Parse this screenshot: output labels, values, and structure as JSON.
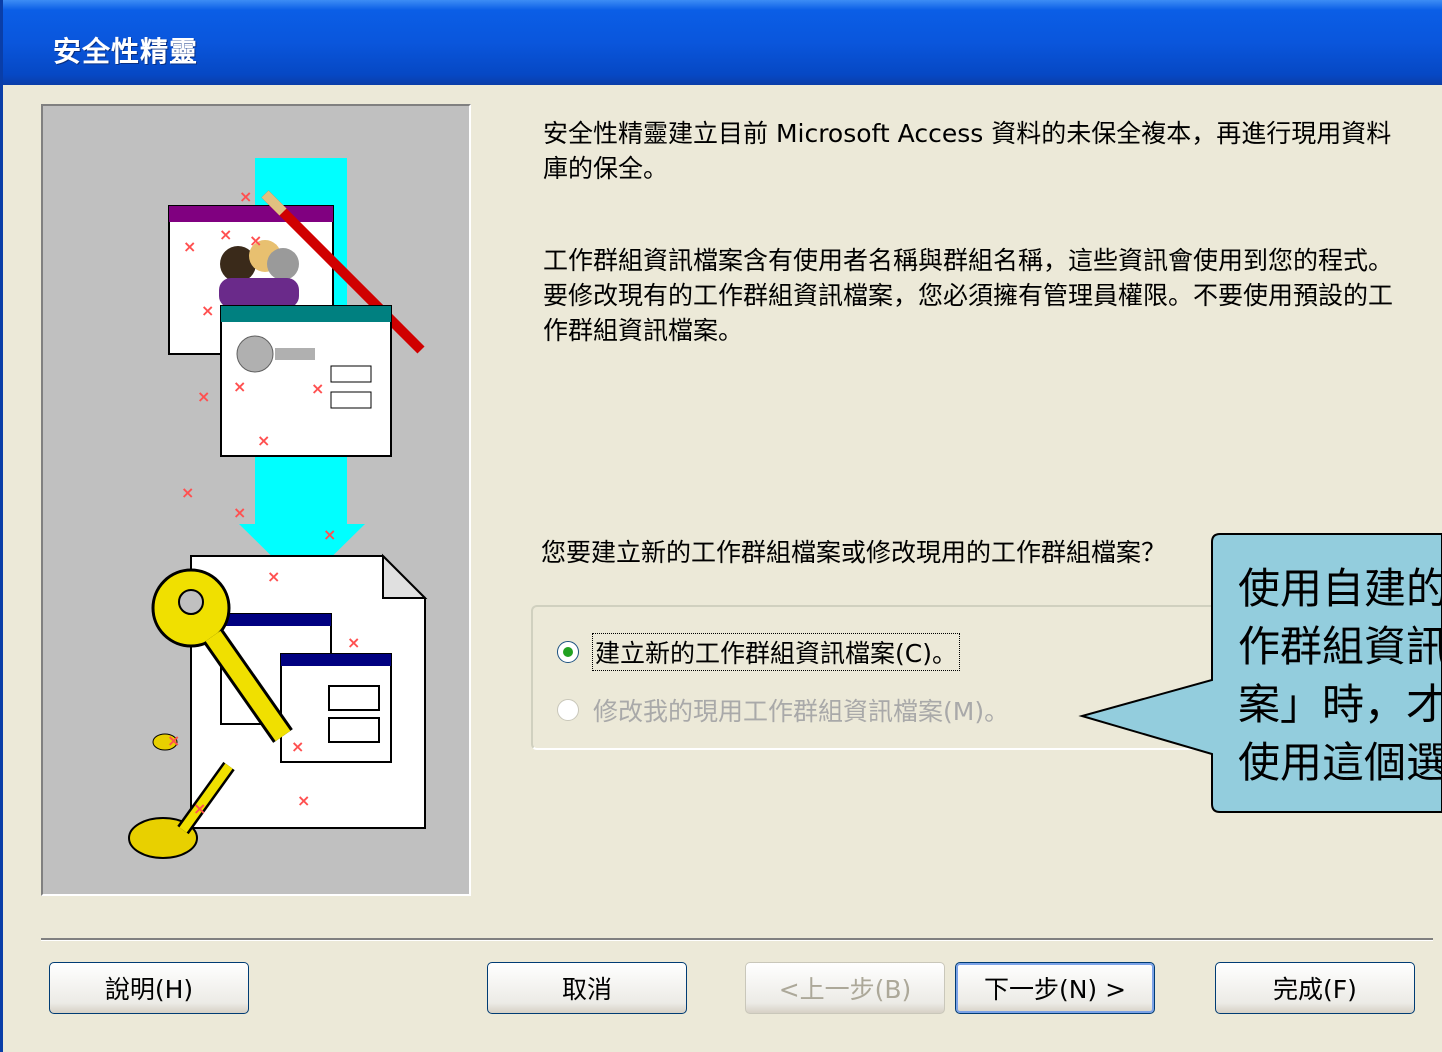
{
  "window": {
    "title": "安全性精靈"
  },
  "intro": {
    "paragraph1": "安全性精靈建立目前 Microsoft Access 資料的未保全複本，再進行現用資料庫的保全。",
    "paragraph2": "工作群組資訊檔案含有使用者名稱與群組名稱，這些資訊會使用到您的程式。要修改現有的工作群組資訊檔案，您必須擁有管理員權限。不要使用預設的工作群組資訊檔案。"
  },
  "question": "您要建立新的工作群組檔案或修改現用的工作群組檔案？",
  "options": [
    {
      "label": "建立新的工作群組資訊檔案(C)。",
      "selected": true,
      "enabled": true
    },
    {
      "label": "修改我的現用工作群組資訊檔案(M)。",
      "selected": false,
      "enabled": false
    }
  ],
  "buttons": {
    "help": "說明(H)",
    "cancel": "取消",
    "back": "<上一步(B)",
    "next": "下一步(N) >",
    "finish": "完成(F)"
  },
  "callout": {
    "text": "使用自建的\n作群組資訊\n案」時，才\n使用這個選"
  },
  "colors": {
    "titlebar": "#0a56dc",
    "callout_fill": "#93cddd",
    "accent_arrow": "#00ffff"
  }
}
